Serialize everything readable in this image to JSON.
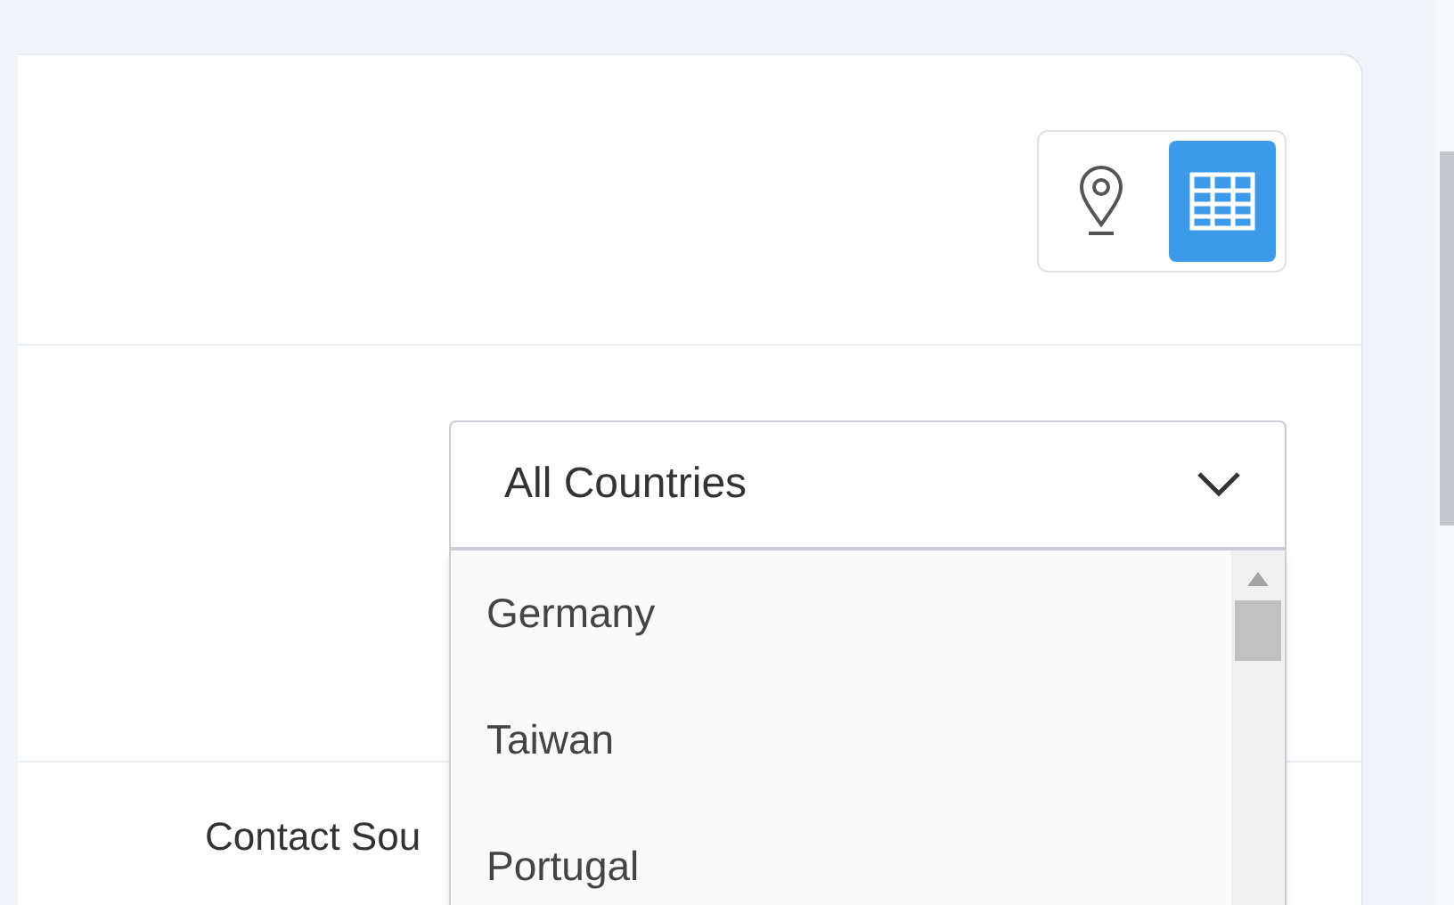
{
  "view_toggle": [
    {
      "kind": "map",
      "selected": false
    },
    {
      "kind": "table",
      "selected": true
    }
  ],
  "country_select": {
    "value": "All Countries",
    "expanded": true,
    "options": [
      "Germany",
      "Taiwan",
      "Portugal"
    ]
  },
  "field_label": "Contact Sou"
}
